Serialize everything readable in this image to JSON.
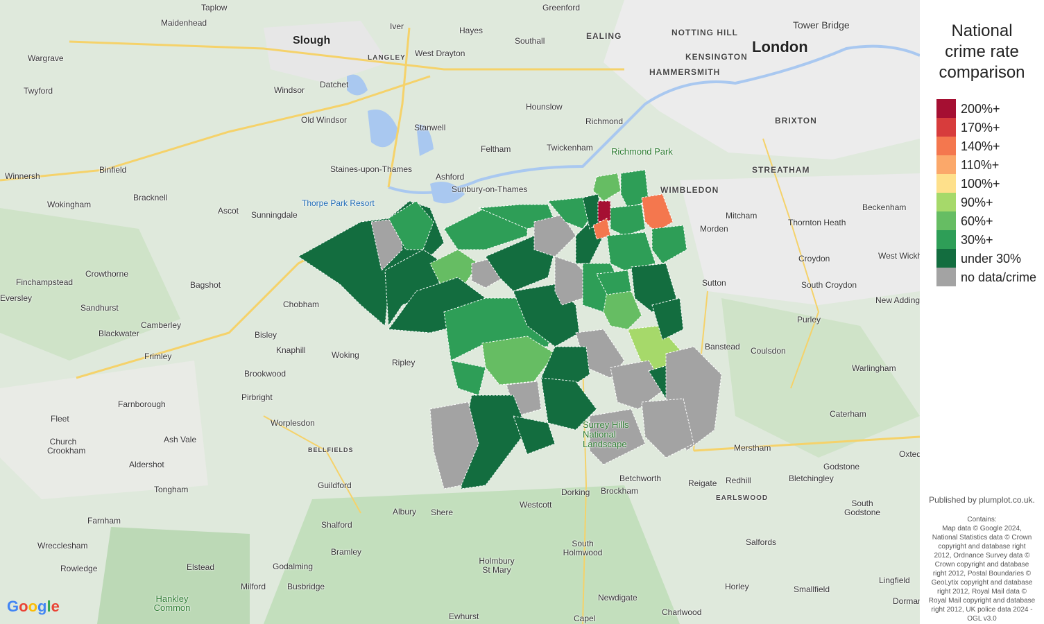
{
  "legend": {
    "title_lines": [
      "National",
      "crime rate",
      "comparison"
    ],
    "items": [
      {
        "label": "200%+",
        "color": "#a50f32"
      },
      {
        "label": "170%+",
        "color": "#d73c3c"
      },
      {
        "label": "140%+",
        "color": "#f4774e"
      },
      {
        "label": "110%+",
        "color": "#fba86a"
      },
      {
        "label": "100%+",
        "color": "#fee08b"
      },
      {
        "label": "90%+",
        "color": "#a6d96a"
      },
      {
        "label": "60%+",
        "color": "#66bd63"
      },
      {
        "label": "30%+",
        "color": "#2e9e57"
      },
      {
        "label": "under 30%",
        "color": "#136d3f"
      },
      {
        "label": "no data/crime",
        "color": "#a3a3a3"
      }
    ]
  },
  "publisher": "Published by plumplot.co.uk.",
  "contains_lines": [
    "Contains:",
    "Map data © Google 2024,",
    "National Statistics data © Crown",
    "copyright and database right",
    "2012, Ordnance Survey data ©",
    "Crown copyright and database",
    "right 2012, Postal Boundaries ©",
    "GeoLytix copyright and database",
    "right 2012, Royal Mail data ©",
    "Royal Mail copyright and database",
    "right 2012, UK police data 2024 -",
    "OGL v3.0"
  ],
  "google_logo": "Google",
  "places": [
    {
      "name": "Taplow"
    },
    {
      "name": "Maidenhead"
    },
    {
      "name": "Slough"
    },
    {
      "name": "Iver"
    },
    {
      "name": "Greenford"
    },
    {
      "name": "Hayes"
    },
    {
      "name": "EALING"
    },
    {
      "name": "NOTTING HILL"
    },
    {
      "name": "London"
    },
    {
      "name": "Tower Bridge"
    },
    {
      "name": "LANGLEY"
    },
    {
      "name": "West Drayton"
    },
    {
      "name": "Southall"
    },
    {
      "name": "KENSINGTON"
    },
    {
      "name": "Wargrave"
    },
    {
      "name": "HAMMERSMITH"
    },
    {
      "name": "Twyford"
    },
    {
      "name": "Windsor"
    },
    {
      "name": "Datchet"
    },
    {
      "name": "Hounslow"
    },
    {
      "name": "Old Windsor"
    },
    {
      "name": "Stanwell"
    },
    {
      "name": "Richmond"
    },
    {
      "name": "BRIXTON"
    },
    {
      "name": "Feltham"
    },
    {
      "name": "Twickenham"
    },
    {
      "name": "Richmond Park"
    },
    {
      "name": "Binfield"
    },
    {
      "name": "Staines-upon-Thames"
    },
    {
      "name": "Ashford"
    },
    {
      "name": "STREATHAM"
    },
    {
      "name": "Winnersh"
    },
    {
      "name": "Sunbury-on-Thames"
    },
    {
      "name": "WIMBLEDON"
    },
    {
      "name": "Bracknell"
    },
    {
      "name": "Thorpe Park Resort"
    },
    {
      "name": "Wokingham"
    },
    {
      "name": "Ascot"
    },
    {
      "name": "Beckenham"
    },
    {
      "name": "Mitcham"
    },
    {
      "name": "Sunningdale"
    },
    {
      "name": "Morden"
    },
    {
      "name": "Thornton Heath"
    },
    {
      "name": "Croydon"
    },
    {
      "name": "Crowthorne"
    },
    {
      "name": "West Wickham"
    },
    {
      "name": "Finchampstead"
    },
    {
      "name": "Bagshot"
    },
    {
      "name": "Sutton"
    },
    {
      "name": "South Croydon"
    },
    {
      "name": "Eversley"
    },
    {
      "name": "Chobham"
    },
    {
      "name": "Sandhurst"
    },
    {
      "name": "New Addington"
    },
    {
      "name": "Camberley"
    },
    {
      "name": "Blackwater"
    },
    {
      "name": "Bisley"
    },
    {
      "name": "Purley"
    },
    {
      "name": "Banstead"
    },
    {
      "name": "Knaphill"
    },
    {
      "name": "Coulsdon"
    },
    {
      "name": "Frimley"
    },
    {
      "name": "Woking"
    },
    {
      "name": "Warlingham"
    },
    {
      "name": "Brookwood"
    },
    {
      "name": "Ripley"
    },
    {
      "name": "Pirbright"
    },
    {
      "name": "Farnborough"
    },
    {
      "name": "Caterham"
    },
    {
      "name": "Fleet"
    },
    {
      "name": "Worplesdon"
    },
    {
      "name": "Surrey Hills National Landscape"
    },
    {
      "name": "Ash Vale"
    },
    {
      "name": "Church Crookham"
    },
    {
      "name": "BELLFIELDS"
    },
    {
      "name": "Merstham"
    },
    {
      "name": "Oxted"
    },
    {
      "name": "Godstone"
    },
    {
      "name": "Aldershot"
    },
    {
      "name": "Guildford"
    },
    {
      "name": "Redhill"
    },
    {
      "name": "Betchworth"
    },
    {
      "name": "Reigate"
    },
    {
      "name": "Bletchingley"
    },
    {
      "name": "Tongham"
    },
    {
      "name": "Dorking"
    },
    {
      "name": "Brockham"
    },
    {
      "name": "EARLSWOOD"
    },
    {
      "name": "South Godstone"
    },
    {
      "name": "Westcott"
    },
    {
      "name": "Farnham"
    },
    {
      "name": "Albury"
    },
    {
      "name": "Shere"
    },
    {
      "name": "Shalford"
    },
    {
      "name": "South Holmwood"
    },
    {
      "name": "Salfords"
    },
    {
      "name": "Wrecclesham"
    },
    {
      "name": "Bramley"
    },
    {
      "name": "Rowledge"
    },
    {
      "name": "Elstead"
    },
    {
      "name": "Godalming"
    },
    {
      "name": "Holmbury St Mary"
    },
    {
      "name": "Lingfield"
    },
    {
      "name": "Milford"
    },
    {
      "name": "Busbridge"
    },
    {
      "name": "Horley"
    },
    {
      "name": "Smallfield"
    },
    {
      "name": "Hankley Common"
    },
    {
      "name": "Newdigate"
    },
    {
      "name": "Dormans"
    },
    {
      "name": "Charlwood"
    },
    {
      "name": "Ewhurst"
    },
    {
      "name": "Capel"
    }
  ]
}
